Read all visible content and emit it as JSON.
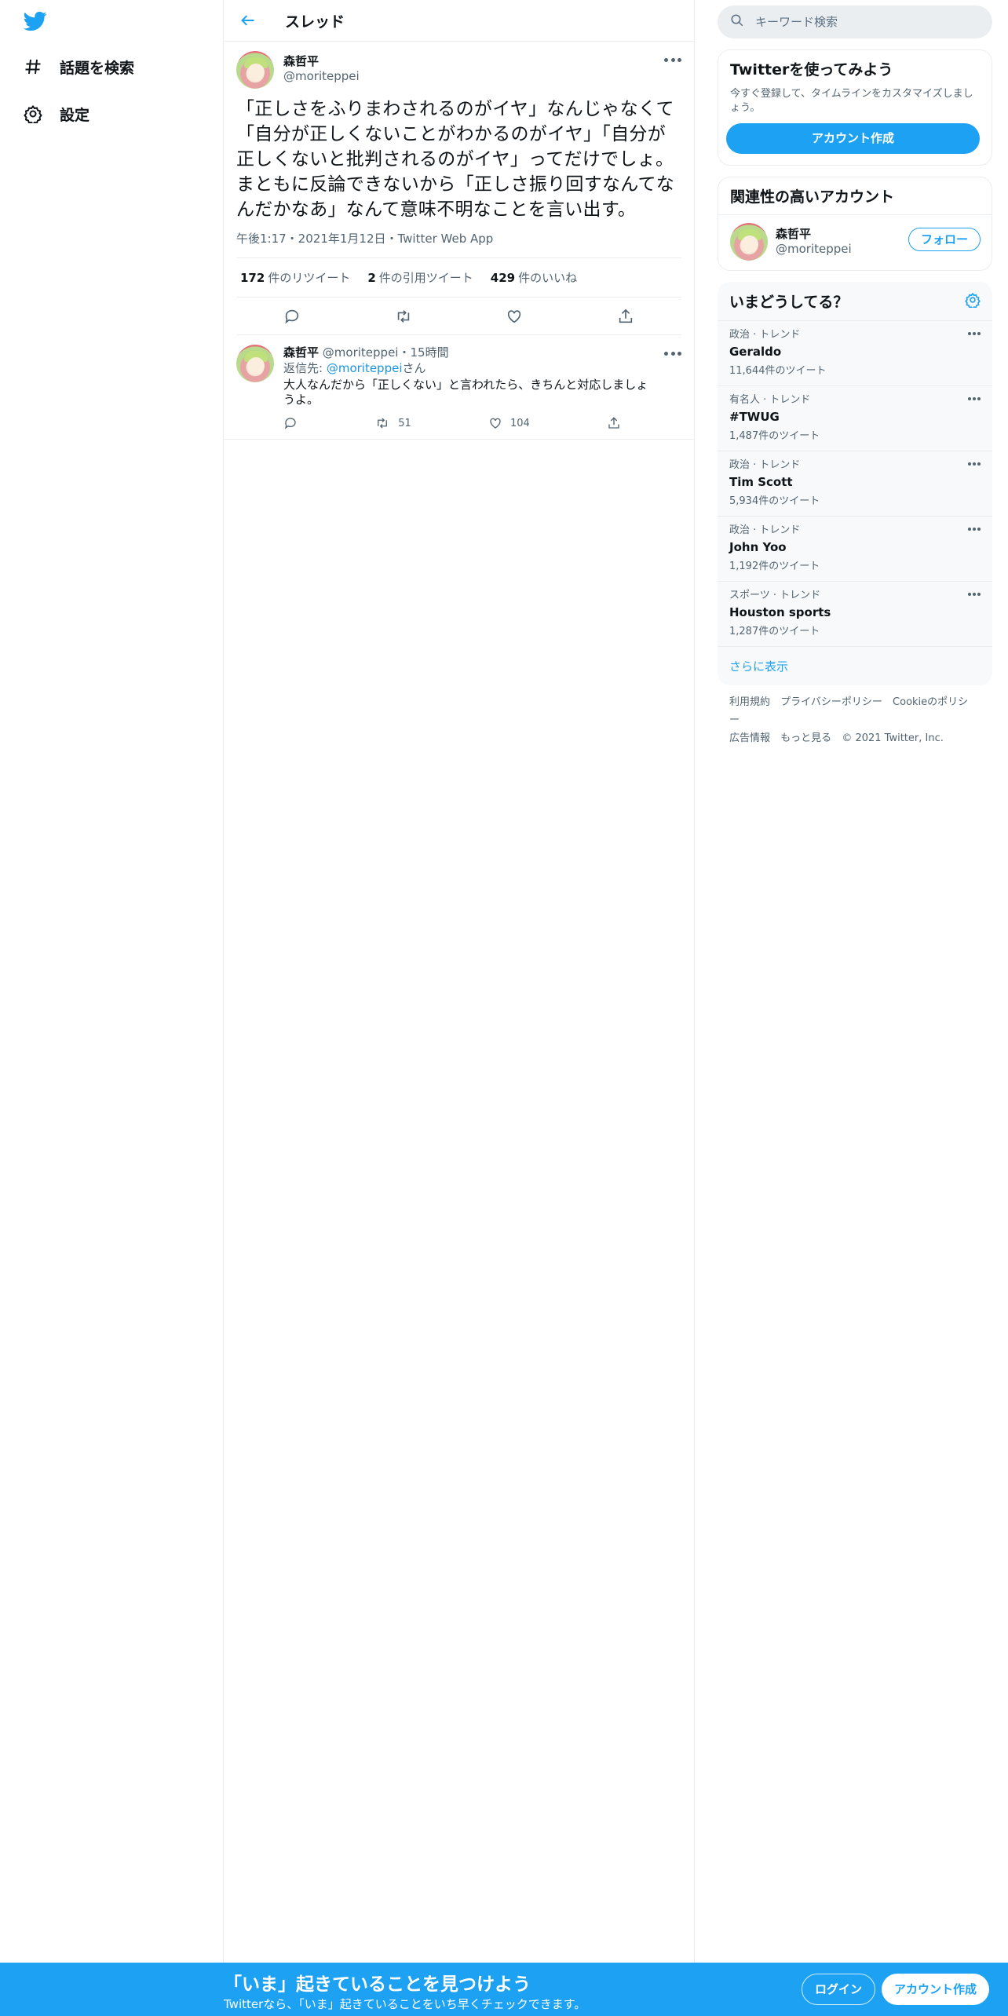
{
  "nav": {
    "logo": "twitter-bird-logo",
    "items": [
      {
        "label": "話題を検索",
        "icon": "hashtag-icon"
      },
      {
        "label": "設定",
        "icon": "gear-icon"
      }
    ]
  },
  "header": {
    "title": "スレッド"
  },
  "main_tweet": {
    "name": "森哲平",
    "handle": "@moriteppei",
    "text": "「正しさをふりまわされるのがイヤ」なんじゃなくて「自分が正しくないことがわかるのがイヤ」「自分が正しくないと批判されるのがイヤ」ってだけでしょ。まともに反論できないから「正しさ振り回すなんてなんだかなあ」なんて意味不明なことを言い出す。",
    "meta": "午後1:17・2021年1月12日・Twitter Web App",
    "stats": {
      "retweets_count": "172",
      "retweets_label": "件のリツイート",
      "quotes_count": "2",
      "quotes_label": "件の引用ツイート",
      "likes_count": "429",
      "likes_label": "件のいいね"
    }
  },
  "reply": {
    "name": "森哲平",
    "handle": "@moriteppei",
    "sep": "・",
    "time": "15時間",
    "reply_to_prefix": "返信先: ",
    "reply_to_handle": "@moriteppei",
    "reply_to_suffix": "さん",
    "text": "大人なんだから「正しくない」と言われたら、きちんと対応しましょうよ。",
    "retweets": "51",
    "likes": "104"
  },
  "search": {
    "placeholder": "キーワード検索"
  },
  "signup_card": {
    "title": "Twitterを使ってみよう",
    "text": "今すぐ登録して、タイムラインをカスタマイズしましょう。",
    "button": "アカウント作成"
  },
  "related": {
    "title": "関連性の高いアカウント",
    "name": "森哲平",
    "handle": "@moriteppei",
    "follow": "フォロー"
  },
  "trends": {
    "title": "いまどうしてる？",
    "items": [
      {
        "category": "政治 · トレンド",
        "name": "Geraldo",
        "count": "11,644件のツイート"
      },
      {
        "category": "有名人 · トレンド",
        "name": "#TWUG",
        "count": "1,487件のツイート"
      },
      {
        "category": "政治 · トレンド",
        "name": "Tim Scott",
        "count": "5,934件のツイート"
      },
      {
        "category": "政治 · トレンド",
        "name": "John Yoo",
        "count": "1,192件のツイート"
      },
      {
        "category": "スポーツ · トレンド",
        "name": "Houston sports",
        "count": "1,287件のツイート"
      }
    ],
    "show_more": "さらに表示"
  },
  "footer": {
    "terms": "利用規約",
    "privacy": "プライバシーポリシー",
    "cookie": "Cookieのポリシー",
    "ads": "広告情報",
    "more": "もっと見る",
    "copyright": "© 2021 Twitter, Inc."
  },
  "bottom_bar": {
    "title": "「いま」起きていることを見つけよう",
    "subtitle": "Twitterなら、「いま」起きていることをいち早くチェックできます。",
    "login": "ログイン",
    "signup": "アカウント作成"
  },
  "colors": {
    "accent": "#1da1f2",
    "text": "#0f1419",
    "secondary": "#536471"
  }
}
